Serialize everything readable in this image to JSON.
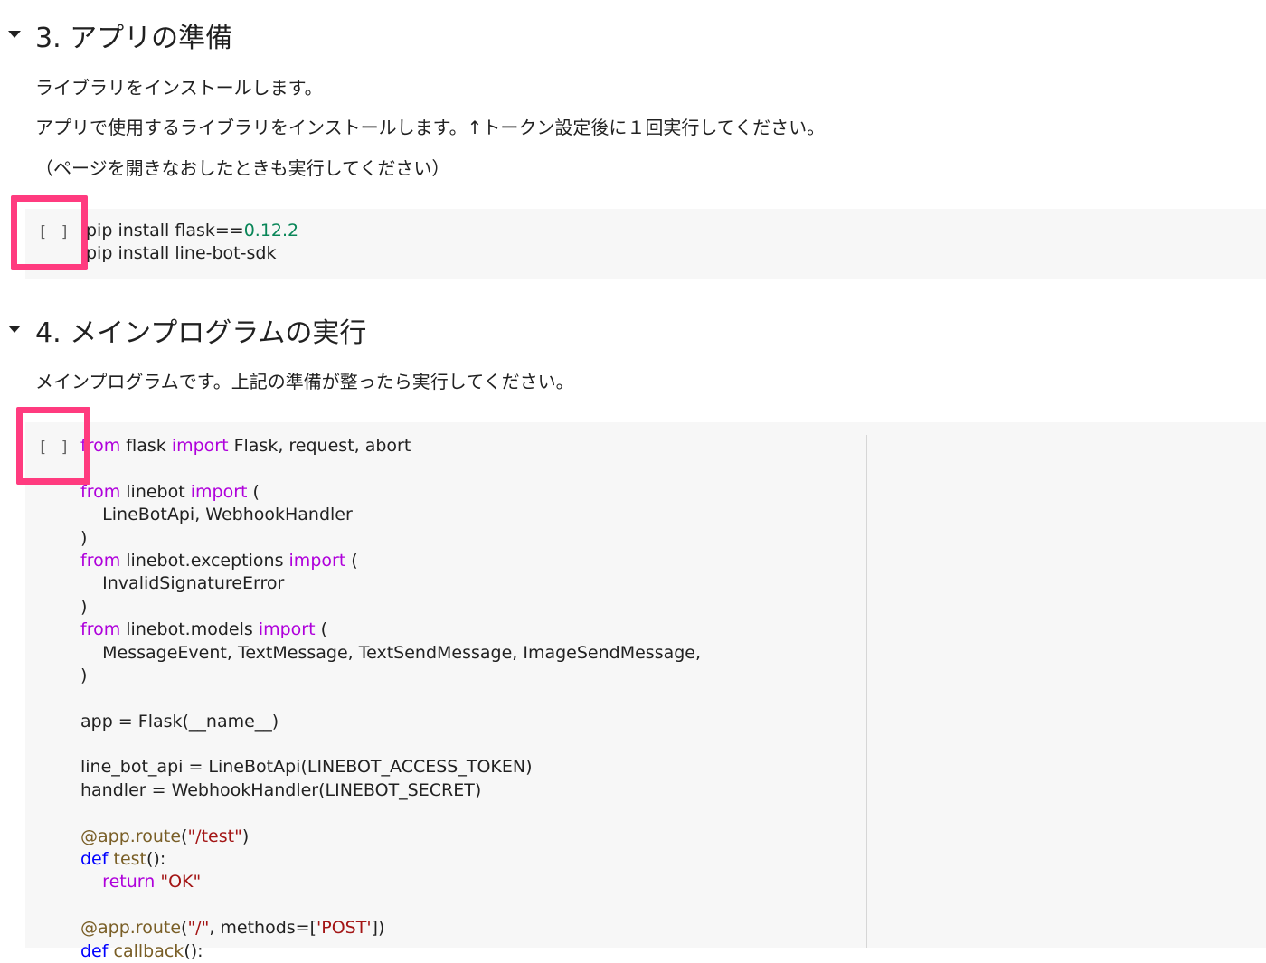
{
  "section3": {
    "title": "3. アプリの準備",
    "lines": [
      "ライブラリをインストールします。",
      "アプリで使用するライブラリをインストールします。↑トークン設定後に１回実行してください。",
      "（ページを開きなおしたときも実行してください）"
    ]
  },
  "cell1": {
    "run_label": "[ ]",
    "code": [
      [
        {
          "t": "pip install flask=="
        },
        {
          "t": "0.12.2",
          "c": "num"
        }
      ],
      [
        {
          "t": "pip install line-bot-sdk"
        }
      ]
    ]
  },
  "section4": {
    "title": "4. メインプログラムの実行",
    "lines": [
      "メインプログラムです。上記の準備が整ったら実行してください。"
    ]
  },
  "cell2": {
    "run_label": "[ ]",
    "code": [
      [
        {
          "t": "from",
          "c": "kw"
        },
        {
          "t": " flask "
        },
        {
          "t": "import",
          "c": "kw"
        },
        {
          "t": " Flask, request, abort"
        }
      ],
      [],
      [
        {
          "t": "from",
          "c": "kw"
        },
        {
          "t": " linebot "
        },
        {
          "t": "import",
          "c": "kw"
        },
        {
          "t": " ("
        }
      ],
      [
        {
          "t": "    LineBotApi, WebhookHandler"
        }
      ],
      [
        {
          "t": ")"
        }
      ],
      [
        {
          "t": "from",
          "c": "kw"
        },
        {
          "t": " linebot.exceptions "
        },
        {
          "t": "import",
          "c": "kw"
        },
        {
          "t": " ("
        }
      ],
      [
        {
          "t": "    InvalidSignatureError"
        }
      ],
      [
        {
          "t": ")"
        }
      ],
      [
        {
          "t": "from",
          "c": "kw"
        },
        {
          "t": " linebot.models "
        },
        {
          "t": "import",
          "c": "kw"
        },
        {
          "t": " ("
        }
      ],
      [
        {
          "t": "    MessageEvent, TextMessage, TextSendMessage, ImageSendMessage,"
        }
      ],
      [
        {
          "t": ")"
        }
      ],
      [],
      [
        {
          "t": "app = Flask(__name__)"
        }
      ],
      [],
      [
        {
          "t": "line_bot_api = LineBotApi(LINEBOT_ACCESS_TOKEN)"
        }
      ],
      [
        {
          "t": "handler = WebhookHandler(LINEBOT_SECRET)"
        }
      ],
      [],
      [
        {
          "t": "@app.route",
          "c": "fn"
        },
        {
          "t": "("
        },
        {
          "t": "\"/test\"",
          "c": "str"
        },
        {
          "t": ")"
        }
      ],
      [
        {
          "t": "def",
          "c": "def"
        },
        {
          "t": " "
        },
        {
          "t": "test",
          "c": "fn"
        },
        {
          "t": "():"
        }
      ],
      [
        {
          "t": "    "
        },
        {
          "t": "return",
          "c": "kw"
        },
        {
          "t": " "
        },
        {
          "t": "\"OK\"",
          "c": "str"
        }
      ],
      [],
      [
        {
          "t": "@app.route",
          "c": "fn"
        },
        {
          "t": "("
        },
        {
          "t": "\"/\"",
          "c": "str"
        },
        {
          "t": ", methods=["
        },
        {
          "t": "'POST'",
          "c": "str"
        },
        {
          "t": "])"
        }
      ],
      [
        {
          "t": "def",
          "c": "def"
        },
        {
          "t": " "
        },
        {
          "t": "callback",
          "c": "fn"
        },
        {
          "t": "():"
        }
      ]
    ]
  },
  "colors": {
    "highlight": "#ff3b7f",
    "cell_background": "#f7f7f7",
    "keyword": "#af00db",
    "def_keyword": "#0000ff",
    "number": "#098658",
    "string": "#a31515",
    "decorator": "#795e26"
  }
}
